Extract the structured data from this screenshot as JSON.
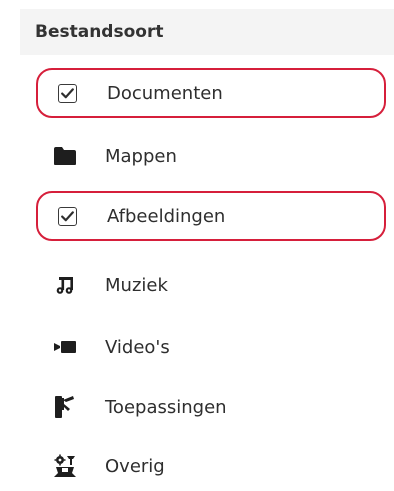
{
  "panel": {
    "title": "Bestandsoort",
    "items": [
      {
        "label": "Documenten",
        "icon": "checkbox-icon",
        "checked": true,
        "highlighted": true
      },
      {
        "label": "Mappen",
        "icon": "folder-icon"
      },
      {
        "label": "Afbeeldingen",
        "icon": "checkbox-icon",
        "checked": true,
        "highlighted": true
      },
      {
        "label": "Muziek",
        "icon": "music-note-icon"
      },
      {
        "label": "Video's",
        "icon": "video-camera-icon"
      },
      {
        "label": "Toepassingen",
        "icon": "application-icon"
      },
      {
        "label": "Overig",
        "icon": "other-icon"
      }
    ]
  },
  "colors": {
    "highlight": "#d61f3b",
    "header_bg": "#f4f4f4",
    "text": "#2e2e2e"
  }
}
